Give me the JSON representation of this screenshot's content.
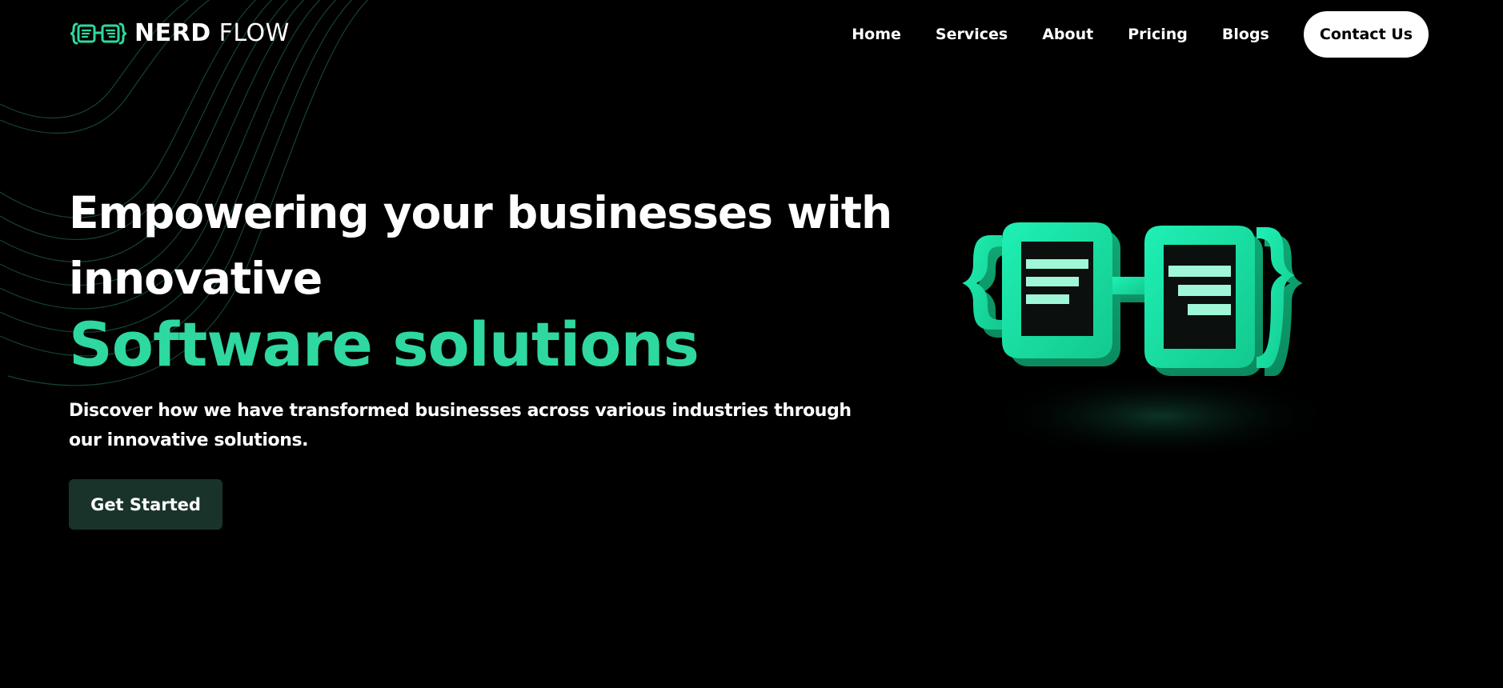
{
  "brand": {
    "name_bold": "NERD",
    "name_light": "FLOW",
    "accent_color": "#2ed8a0",
    "logo_icon": "code-brackets-glasses-icon"
  },
  "nav": {
    "items": [
      {
        "label": "Home"
      },
      {
        "label": "Services"
      },
      {
        "label": "About"
      },
      {
        "label": "Pricing"
      },
      {
        "label": "Blogs"
      }
    ],
    "contact_label": "Contact Us"
  },
  "hero": {
    "heading_line1": "Empowering your businesses with",
    "heading_line2": "innovative",
    "heading_accent": "Software solutions",
    "subtitle": "Discover how we have transformed businesses across various industries through our innovative solutions.",
    "cta_label": "Get Started",
    "cta_color": "#19332b",
    "illustration": "3d-code-glasses-icon"
  }
}
